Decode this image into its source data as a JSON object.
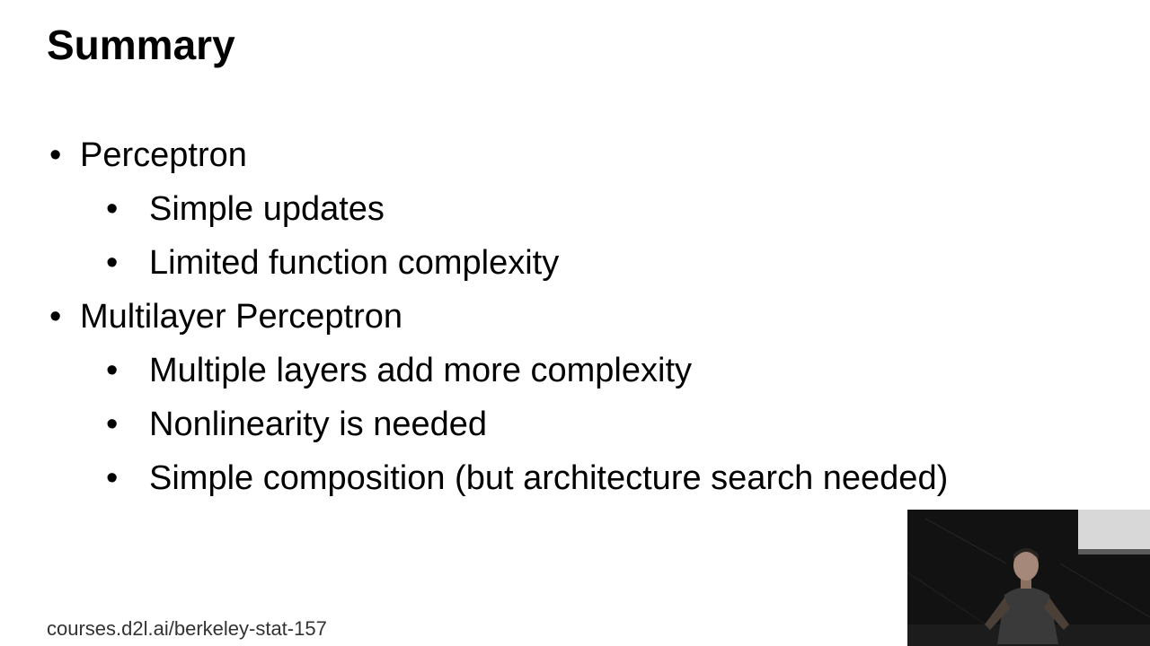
{
  "slide": {
    "title": "Summary",
    "bullets": [
      {
        "level": 1,
        "text": "Perceptron"
      },
      {
        "level": 2,
        "text": "Simple updates"
      },
      {
        "level": 2,
        "text": "Limited function complexity"
      },
      {
        "level": 1,
        "text": "Multilayer Perceptron"
      },
      {
        "level": 2,
        "text": "Multiple layers add more complexity"
      },
      {
        "level": 2,
        "text": "Nonlinearity is needed"
      },
      {
        "level": 2,
        "text": "Simple composition (but architecture search needed)"
      }
    ],
    "bullet_glyph": "•",
    "footer_url": "courses.d2l.ai/berkeley-stat-157"
  },
  "colors": {
    "background": "#ffffff",
    "text": "#000000",
    "footer_text": "#333333",
    "video_background": "#111111"
  }
}
